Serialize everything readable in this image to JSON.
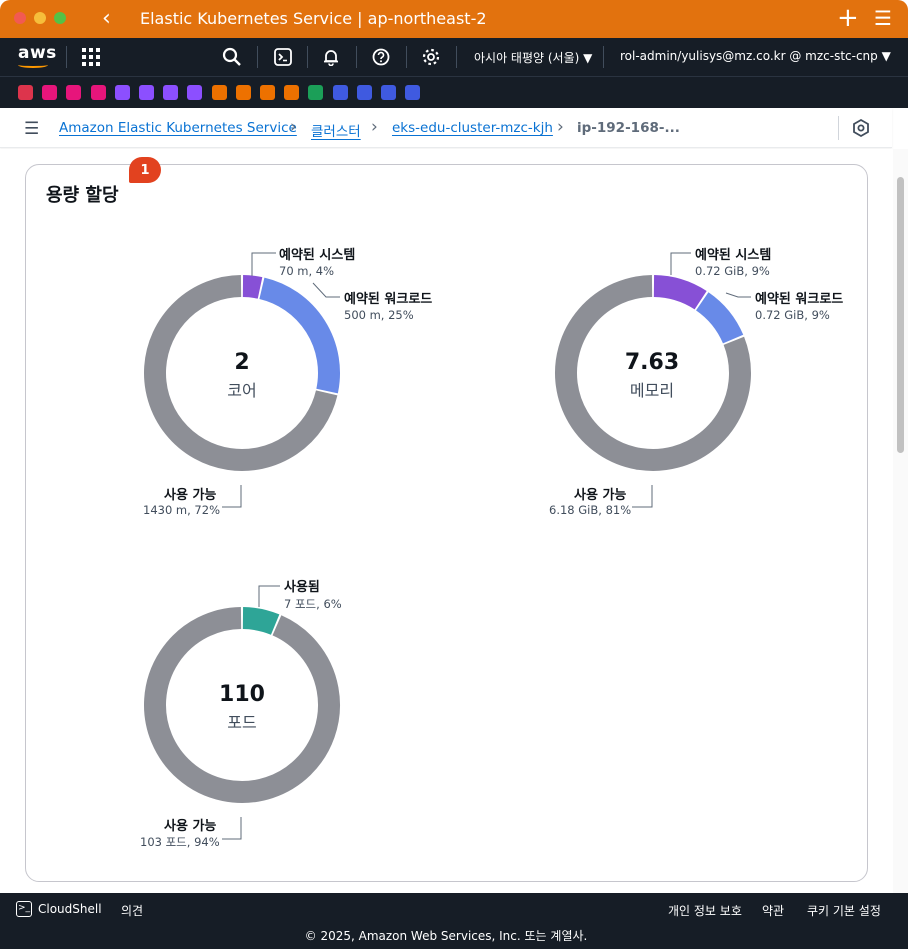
{
  "window": {
    "title": "Elastic Kubernetes Service | ap-northeast-2"
  },
  "aws_nav": {
    "logo": "aws",
    "region": "아시아 태평양 (서울)",
    "account": "rol-admin/yulisys@mz.co.kr @ mzc-stc-cnp"
  },
  "favorites": [
    {
      "icon": "ec2-icon",
      "color": "#dd344c"
    },
    {
      "icon": "cloudwatch-icon",
      "color": "#e7157b"
    },
    {
      "icon": "cloudfront-icon",
      "color": "#e7157b"
    },
    {
      "icon": "apigateway-icon",
      "color": "#e7157b"
    },
    {
      "icon": "iam-icon",
      "color": "#8c4fff"
    },
    {
      "icon": "vpc-icon",
      "color": "#8c4fff"
    },
    {
      "icon": "route53-icon",
      "color": "#8c4fff"
    },
    {
      "icon": "elb-icon",
      "color": "#8c4fff"
    },
    {
      "icon": "ecs-icon",
      "color": "#ed7100"
    },
    {
      "icon": "eks-icon",
      "color": "#ed7100"
    },
    {
      "icon": "ecr-icon",
      "color": "#ed7100"
    },
    {
      "icon": "lambda-icon",
      "color": "#ed7100"
    },
    {
      "icon": "s3-icon",
      "color": "#1b9f58"
    },
    {
      "icon": "codebuild-icon",
      "color": "#3f5ae0"
    },
    {
      "icon": "codepipeline-icon",
      "color": "#3f5ae0"
    },
    {
      "icon": "cloudshell-icon",
      "color": "#3f5ae0"
    },
    {
      "icon": "marketplace-icon",
      "color": "#3f5ae0"
    }
  ],
  "breadcrumb": {
    "items": [
      "Amazon Elastic Kubernetes Service",
      "클러스터",
      "eks-edu-cluster-mzc-kjh"
    ],
    "current": "ip-192-168-..."
  },
  "panel": {
    "title": "용량 할당",
    "badge": "1"
  },
  "capacity": {
    "cpu": {
      "center_value": "2",
      "center_label": "코어",
      "segments": [
        {
          "title": "예약된 시스템",
          "detail": "70 m, 4%",
          "fraction": 0.035,
          "color": "#8750d6"
        },
        {
          "title": "예약된 워크로드",
          "detail": "500 m, 25%",
          "fraction": 0.25,
          "color": "#688ae8"
        },
        {
          "title": "사용 가능",
          "detail": "1430 m, 72%",
          "fraction": 0.715,
          "color": "#8d8f96"
        }
      ]
    },
    "memory": {
      "center_value": "7.63",
      "center_label": "메모리",
      "segments": [
        {
          "title": "예약된 시스템",
          "detail": "0.72 GiB, 9%",
          "fraction": 0.094,
          "color": "#8750d6"
        },
        {
          "title": "예약된 워크로드",
          "detail": "0.72 GiB, 9%",
          "fraction": 0.094,
          "color": "#688ae8"
        },
        {
          "title": "사용 가능",
          "detail": "6.18 GiB, 81%",
          "fraction": 0.812,
          "color": "#8d8f96"
        }
      ]
    },
    "pods": {
      "center_value": "110",
      "center_label": "포드",
      "segments": [
        {
          "title": "사용됨",
          "detail": "7 포드, 6%",
          "fraction": 0.064,
          "color": "#2ea597"
        },
        {
          "title": "사용 가능",
          "detail": "103 포드, 94%",
          "fraction": 0.936,
          "color": "#8d8f96"
        }
      ]
    }
  },
  "footer": {
    "cloudshell": "CloudShell",
    "feedback": "의견",
    "privacy": "개인 정보 보호",
    "terms": "약관",
    "cookies": "쿠키 기본 설정",
    "copyright": "© 2025, Amazon Web Services, Inc. 또는 계열사."
  }
}
